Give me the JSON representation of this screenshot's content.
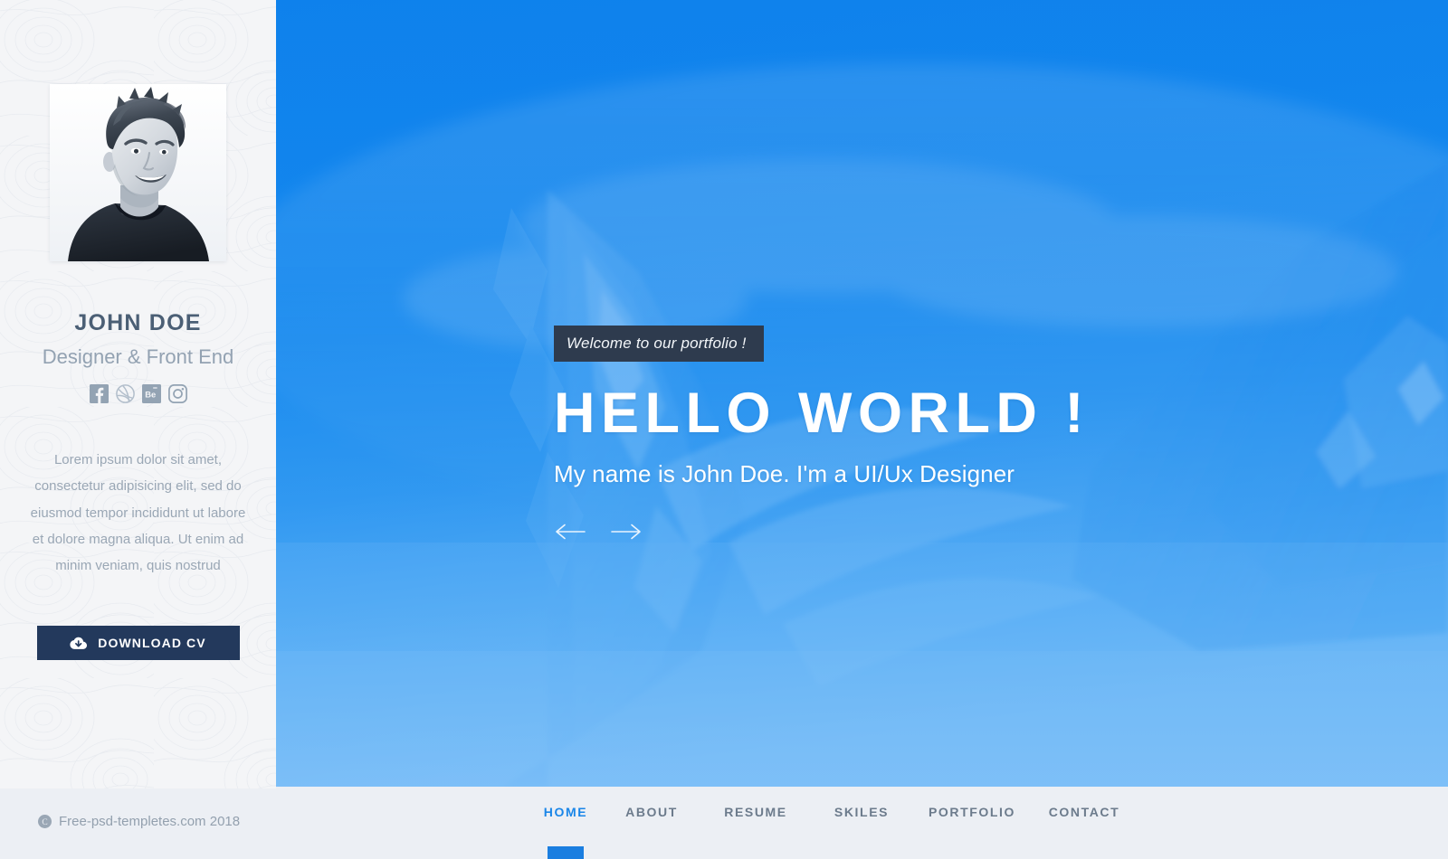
{
  "sidebar": {
    "avatar_alt": "portrait-photo",
    "name": "JOHN DOE",
    "role": "Designer & Front End",
    "socials": [
      {
        "name": "facebook-icon",
        "label": "Facebook"
      },
      {
        "name": "dribbble-icon",
        "label": "Dribbble"
      },
      {
        "name": "behance-icon",
        "label": "Behance"
      },
      {
        "name": "instagram-icon",
        "label": "Instagram"
      }
    ],
    "bio": "Lorem ipsum dolor sit amet, consectetur adipisicing elit, sed do eiusmod tempor incididunt ut labore et dolore magna aliqua. Ut enim ad minim veniam, quis nostrud",
    "download_label": "DOWNLOAD CV"
  },
  "hero": {
    "badge": "Welcome to our portfolio !",
    "title": "HELLO WORLD !",
    "subtitle": "My name is John Doe. I'm a UI/Ux Designer",
    "prev_label": "previous-slide",
    "next_label": "next-slide"
  },
  "footer": {
    "copyright": "Free-psd-templetes.com 2018",
    "nav": [
      {
        "label": "HOME",
        "active": true
      },
      {
        "label": "ABOUT",
        "active": false
      },
      {
        "label": "RESUME",
        "active": false
      },
      {
        "label": "SKILES",
        "active": false
      },
      {
        "label": "PORTFOLIO",
        "active": false
      },
      {
        "label": "CONTACT",
        "active": false
      }
    ]
  },
  "colors": {
    "hero_blue": "#1189ee",
    "accent_blue": "#1a86e8",
    "dark_navy": "#23395c",
    "badge_navy": "#2e3b4e",
    "sidebar_bg": "#f4f5f7",
    "footer_bg": "#eceff4",
    "name_color": "#4b5f75",
    "muted_text": "#93a2b2"
  }
}
